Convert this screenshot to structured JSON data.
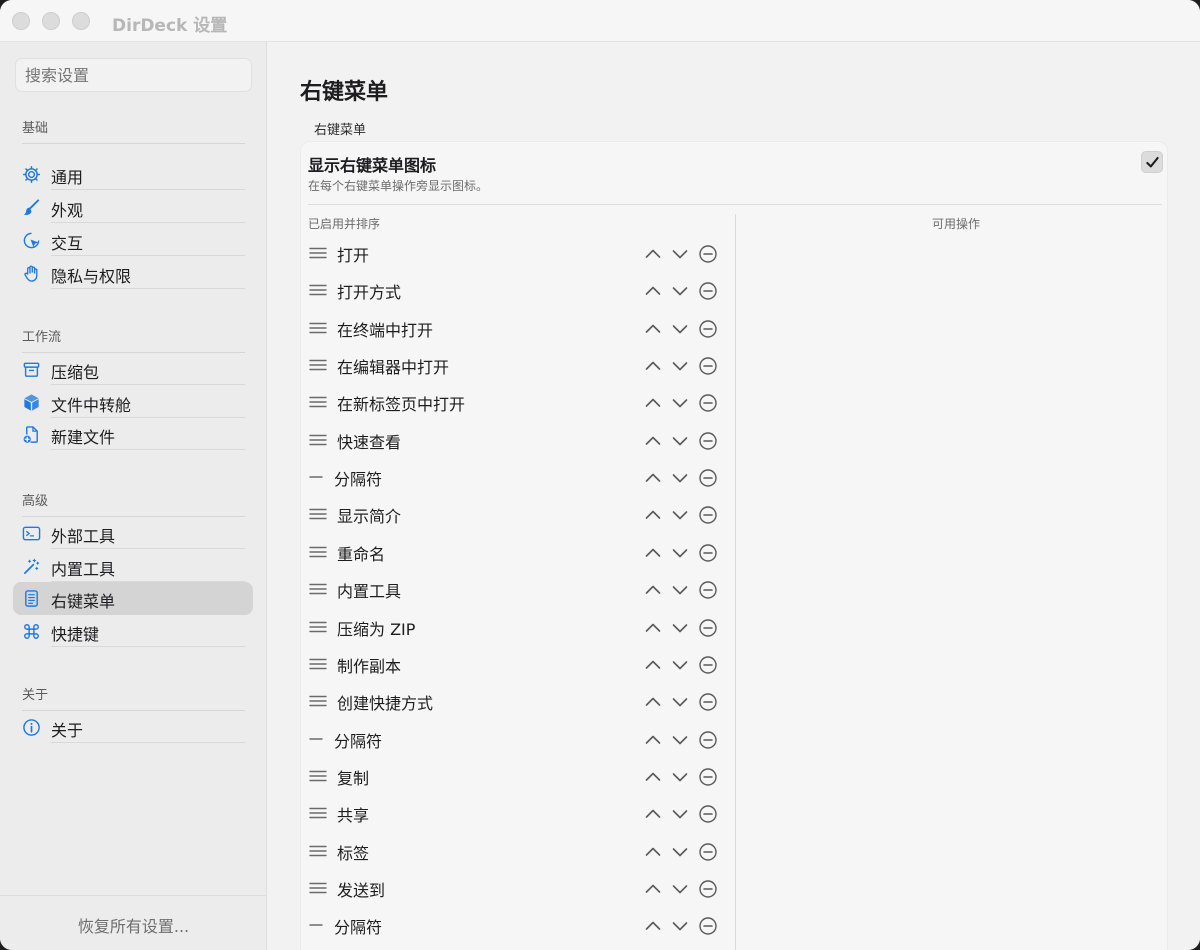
{
  "window": {
    "title": "DirDeck 设置"
  },
  "sidebar": {
    "search_placeholder": "搜索设置",
    "groups": [
      {
        "title": "基础",
        "items": [
          {
            "label": "通用",
            "icon": "gear-icon"
          },
          {
            "label": "外观",
            "icon": "paintbrush-icon"
          },
          {
            "label": "交互",
            "icon": "cursor-click-icon"
          },
          {
            "label": "隐私与权限",
            "icon": "hand-icon"
          }
        ]
      },
      {
        "title": "工作流",
        "items": [
          {
            "label": "压缩包",
            "icon": "archive-box-icon"
          },
          {
            "label": "文件中转舱",
            "icon": "cube-icon"
          },
          {
            "label": "新建文件",
            "icon": "new-document-icon"
          }
        ]
      },
      {
        "title": "高级",
        "items": [
          {
            "label": "外部工具",
            "icon": "terminal-icon"
          },
          {
            "label": "内置工具",
            "icon": "magic-wand-icon"
          },
          {
            "label": "右键菜单",
            "icon": "document-list-icon",
            "selected": true
          },
          {
            "label": "快捷键",
            "icon": "command-key-icon"
          }
        ]
      },
      {
        "title": "关于",
        "items": [
          {
            "label": "关于",
            "icon": "info-icon"
          }
        ]
      }
    ],
    "reset_label": "恢复所有设置..."
  },
  "main": {
    "page_title": "右键菜单",
    "section_label": "右键菜单",
    "toggle": {
      "title": "显示右键菜单图标",
      "description": "在每个右键菜单操作旁显示图标。",
      "checked": true
    },
    "enabled_header": "已启用并排序",
    "available_header": "可用操作",
    "enabled_items": [
      {
        "label": "打开",
        "separator": false
      },
      {
        "label": "打开方式",
        "separator": false
      },
      {
        "label": "在终端中打开",
        "separator": false
      },
      {
        "label": "在编辑器中打开",
        "separator": false
      },
      {
        "label": "在新标签页中打开",
        "separator": false
      },
      {
        "label": "快速查看",
        "separator": false
      },
      {
        "label": "分隔符",
        "separator": true
      },
      {
        "label": "显示简介",
        "separator": false
      },
      {
        "label": "重命名",
        "separator": false
      },
      {
        "label": "内置工具",
        "separator": false
      },
      {
        "label": "压缩为 ZIP",
        "separator": false
      },
      {
        "label": "制作副本",
        "separator": false
      },
      {
        "label": "创建快捷方式",
        "separator": false
      },
      {
        "label": "分隔符",
        "separator": true
      },
      {
        "label": "复制",
        "separator": false
      },
      {
        "label": "共享",
        "separator": false
      },
      {
        "label": "标签",
        "separator": false
      },
      {
        "label": "发送到",
        "separator": false
      },
      {
        "label": "分隔符",
        "separator": true
      }
    ]
  }
}
